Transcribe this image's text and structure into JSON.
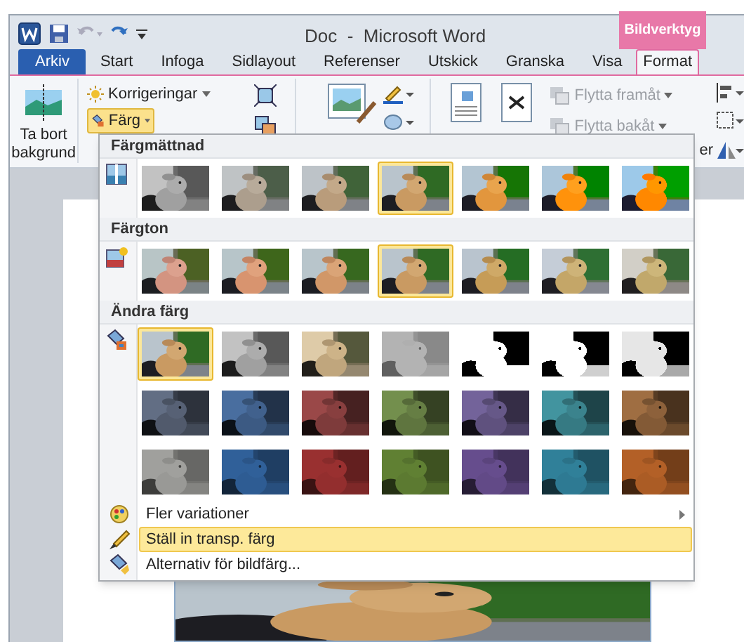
{
  "window": {
    "title": "Doc  -  Microsoft Word",
    "context_tab": "Bildverktyg"
  },
  "tabs": [
    {
      "label": "Arkiv",
      "kind": "file",
      "selected": false
    },
    {
      "label": "Start",
      "kind": "tab",
      "selected": false
    },
    {
      "label": "Infoga",
      "kind": "tab",
      "selected": false
    },
    {
      "label": "Sidlayout",
      "kind": "tab",
      "selected": false
    },
    {
      "label": "Referenser",
      "kind": "tab",
      "selected": false
    },
    {
      "label": "Utskick",
      "kind": "tab",
      "selected": false
    },
    {
      "label": "Granska",
      "kind": "tab",
      "selected": false
    },
    {
      "label": "Visa",
      "kind": "tab",
      "selected": false
    },
    {
      "label": "Format",
      "kind": "tab",
      "selected": true
    }
  ],
  "ribbon": {
    "remove_background": "Ta bort bakgrund",
    "corrections": "Korrigeringar",
    "color_button": {
      "label": "Färg",
      "selected": true
    },
    "bring_forward": {
      "label": "Flytta framåt",
      "disabled": true
    },
    "send_backward": {
      "label": "Flytta bakåt",
      "disabled": true
    },
    "cut_label": "er"
  },
  "color_menu": {
    "sections": [
      {
        "title": "Färgmättnad",
        "kind": "saturation",
        "thumbnails": [
          {
            "selected": false
          },
          {
            "selected": false
          },
          {
            "selected": false
          },
          {
            "selected": true
          },
          {
            "selected": false
          },
          {
            "selected": false
          },
          {
            "selected": false
          }
        ]
      },
      {
        "title": "Färgton",
        "kind": "tone",
        "thumbnails": [
          {
            "selected": false
          },
          {
            "selected": false
          },
          {
            "selected": false
          },
          {
            "selected": true
          },
          {
            "selected": false
          },
          {
            "selected": false
          },
          {
            "selected": false
          }
        ]
      },
      {
        "title": "Ändra färg",
        "kind": "recolor",
        "thumbnails": [
          {
            "selected": true
          },
          {
            "selected": false
          },
          {
            "selected": false
          },
          {
            "selected": false
          },
          {
            "selected": false
          },
          {
            "selected": false
          },
          {
            "selected": false
          },
          {
            "selected": false
          },
          {
            "selected": false
          },
          {
            "selected": false
          },
          {
            "selected": false
          },
          {
            "selected": false
          },
          {
            "selected": false
          },
          {
            "selected": false
          },
          {
            "selected": false
          },
          {
            "selected": false
          },
          {
            "selected": false
          },
          {
            "selected": false
          },
          {
            "selected": false
          },
          {
            "selected": false
          },
          {
            "selected": false
          }
        ]
      }
    ],
    "items": [
      {
        "label": "Fler variationer",
        "kind": "submenu",
        "highlighted": false
      },
      {
        "label": "Ställ in transp. färg",
        "kind": "pen",
        "highlighted": true
      },
      {
        "label": "Alternativ för bildfärg...",
        "kind": "options",
        "highlighted": false
      }
    ]
  }
}
